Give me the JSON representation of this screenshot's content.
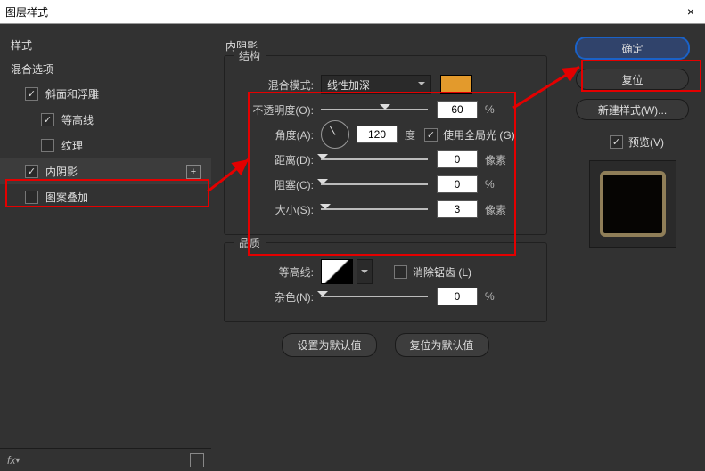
{
  "window": {
    "title": "图层样式",
    "close": "×"
  },
  "left": {
    "styles_header": "样式",
    "blend_options": "混合选项",
    "items": [
      {
        "label": "斜面和浮雕",
        "checked": true
      },
      {
        "label": "等高线",
        "checked": true
      },
      {
        "label": "纹理",
        "checked": false
      },
      {
        "label": "内阴影",
        "checked": true,
        "active": true,
        "plus": true
      },
      {
        "label": "图案叠加",
        "checked": false
      }
    ],
    "fx": "fx"
  },
  "panel": {
    "title": "内阴影",
    "structure": {
      "legend": "结构",
      "blend_mode_label": "混合模式:",
      "blend_mode_value": "线性加深",
      "color": "#e39a2c",
      "opacity_label": "不透明度(O):",
      "opacity_value": "60",
      "opacity_unit": "%",
      "angle_label": "角度(A):",
      "angle_value": "120",
      "angle_unit": "度",
      "global_light_label": "使用全局光 (G)",
      "global_light_checked": true,
      "distance_label": "距离(D):",
      "distance_value": "0",
      "distance_unit": "像素",
      "choke_label": "阻塞(C):",
      "choke_value": "0",
      "choke_unit": "%",
      "size_label": "大小(S):",
      "size_value": "3",
      "size_unit": "像素"
    },
    "quality": {
      "legend": "品质",
      "contour_label": "等高线:",
      "anti_alias_label": "消除锯齿 (L)",
      "anti_alias_checked": false,
      "noise_label": "杂色(N):",
      "noise_value": "0",
      "noise_unit": "%"
    },
    "buttons": {
      "make_default": "设置为默认值",
      "reset_default": "复位为默认值"
    }
  },
  "right": {
    "ok": "确定",
    "reset": "复位",
    "new_style": "新建样式(W)...",
    "preview_label": "预览(V)",
    "preview_checked": true
  },
  "annotations": {
    "highlight_color": "#e40000"
  }
}
